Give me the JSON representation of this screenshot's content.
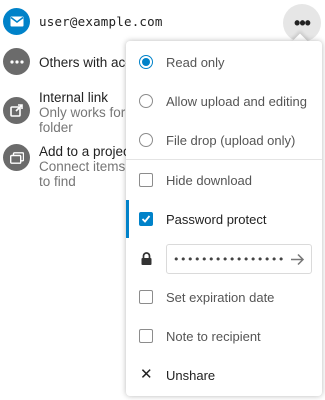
{
  "shares": {
    "email": {
      "icon": "mail-icon",
      "label": "user@example.com"
    },
    "others": {
      "icon": "more-horizontal-icon",
      "label": "Others with acce"
    },
    "internal_link": {
      "icon": "external-link-icon",
      "title": "Internal link",
      "sub1": "Only works for u",
      "sub2": "folder"
    },
    "project": {
      "icon": "folder-stack-icon",
      "title": "Add to a project",
      "sub1": "Connect items t",
      "sub2": "to find"
    }
  },
  "more_button": {
    "label": "•••"
  },
  "menu": {
    "radio_options": [
      {
        "label": "Read only",
        "selected": true
      },
      {
        "label": "Allow upload and editing",
        "selected": false
      },
      {
        "label": "File drop (upload only)",
        "selected": false
      }
    ],
    "hide_download": {
      "label": "Hide download",
      "checked": false
    },
    "password_protect": {
      "label": "Password protect",
      "checked": true
    },
    "password": {
      "value": "••••••••••••••••"
    },
    "expiration": {
      "label": "Set expiration date",
      "checked": false
    },
    "note": {
      "label": "Note to recipient",
      "checked": false
    },
    "unshare": {
      "label": "Unshare"
    }
  },
  "colors": {
    "accent": "#0082c9",
    "avatar_grey": "#6b6b6b"
  }
}
